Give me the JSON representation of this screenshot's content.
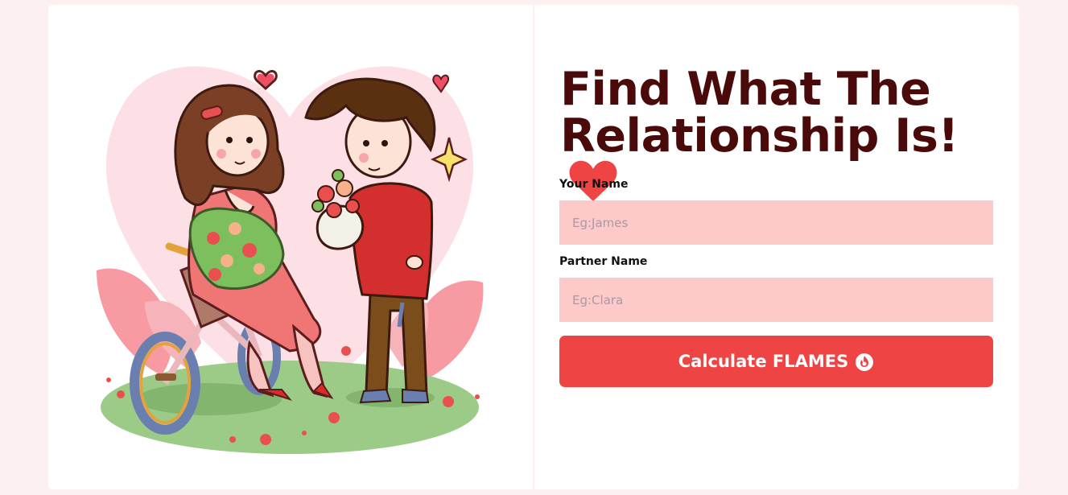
{
  "heading": {
    "title": "Find What The Relationship Is!",
    "title_icon": "heart-icon",
    "accent_color": "#ef4444",
    "title_color": "#4a0a0a"
  },
  "form": {
    "your_name_label": "Your Name",
    "your_name_placeholder": "Eg:James",
    "partner_name_label": "Partner Name",
    "partner_name_placeholder": "Eg:Clara",
    "input_background": "#fec9c9",
    "submit_label": "Calculate FLAMES",
    "submit_icon": "fire-icon"
  },
  "illustration": {
    "subject": "couple-with-bicycle-and-flowers"
  }
}
